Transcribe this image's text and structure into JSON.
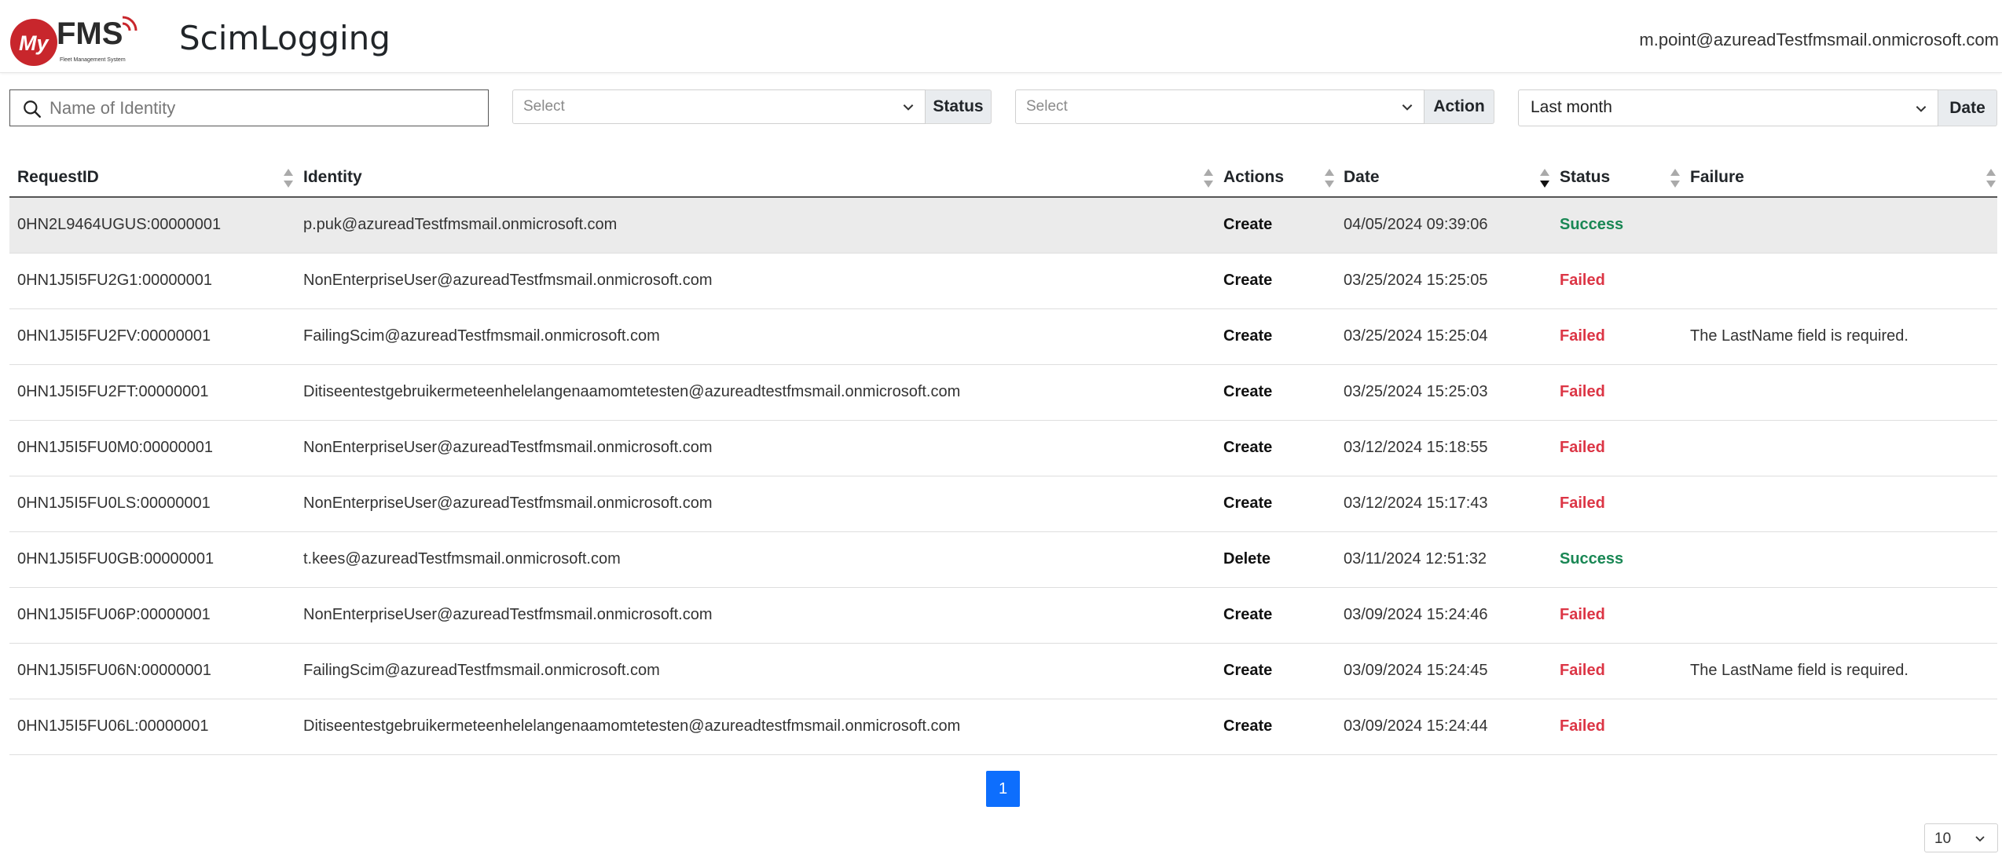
{
  "header": {
    "logo_text": "MyFMS",
    "logo_tagline": "Fleet Management System",
    "title": "ScimLogging",
    "user_email": "m.point@azureadTestfmsmail.onmicrosoft.com"
  },
  "filters": {
    "search_placeholder": "Name of Identity",
    "status": {
      "placeholder": "Select",
      "label": "Status"
    },
    "action": {
      "placeholder": "Select",
      "label": "Action"
    },
    "date": {
      "value": "Last month",
      "label": "Date"
    }
  },
  "table": {
    "columns": [
      "RequestID",
      "Identity",
      "Actions",
      "Date",
      "Status",
      "Failure"
    ],
    "sorted_column": "Date",
    "sort_direction": "descending",
    "highlighted_row": 0,
    "rows": [
      {
        "request_id": "0HN2L9464UGUS:00000001",
        "identity": "p.puk@azureadTestfmsmail.onmicrosoft.com",
        "action": "Create",
        "date": "04/05/2024 09:39:06",
        "status": "Success",
        "failure": ""
      },
      {
        "request_id": "0HN1J5I5FU2G1:00000001",
        "identity": "NonEnterpriseUser@azureadTestfmsmail.onmicrosoft.com",
        "action": "Create",
        "date": "03/25/2024 15:25:05",
        "status": "Failed",
        "failure": ""
      },
      {
        "request_id": "0HN1J5I5FU2FV:00000001",
        "identity": "FailingScim@azureadTestfmsmail.onmicrosoft.com",
        "action": "Create",
        "date": "03/25/2024 15:25:04",
        "status": "Failed",
        "failure": "The LastName field is required."
      },
      {
        "request_id": "0HN1J5I5FU2FT:00000001",
        "identity": "Ditiseentestgebruikermeteenhelelangenaamomtetesten@azureadtestfmsmail.onmicrosoft.com",
        "action": "Create",
        "date": "03/25/2024 15:25:03",
        "status": "Failed",
        "failure": ""
      },
      {
        "request_id": "0HN1J5I5FU0M0:00000001",
        "identity": "NonEnterpriseUser@azureadTestfmsmail.onmicrosoft.com",
        "action": "Create",
        "date": "03/12/2024 15:18:55",
        "status": "Failed",
        "failure": ""
      },
      {
        "request_id": "0HN1J5I5FU0LS:00000001",
        "identity": "NonEnterpriseUser@azureadTestfmsmail.onmicrosoft.com",
        "action": "Create",
        "date": "03/12/2024 15:17:43",
        "status": "Failed",
        "failure": ""
      },
      {
        "request_id": "0HN1J5I5FU0GB:00000001",
        "identity": "t.kees@azureadTestfmsmail.onmicrosoft.com",
        "action": "Delete",
        "date": "03/11/2024 12:51:32",
        "status": "Success",
        "failure": ""
      },
      {
        "request_id": "0HN1J5I5FU06P:00000001",
        "identity": "NonEnterpriseUser@azureadTestfmsmail.onmicrosoft.com",
        "action": "Create",
        "date": "03/09/2024 15:24:46",
        "status": "Failed",
        "failure": ""
      },
      {
        "request_id": "0HN1J5I5FU06N:00000001",
        "identity": "FailingScim@azureadTestfmsmail.onmicrosoft.com",
        "action": "Create",
        "date": "03/09/2024 15:24:45",
        "status": "Failed",
        "failure": "The LastName field is required."
      },
      {
        "request_id": "0HN1J5I5FU06L:00000001",
        "identity": "Ditiseentestgebruikermeteenhelelangenaamomtetesten@azureadtestfmsmail.onmicrosoft.com",
        "action": "Create",
        "date": "03/09/2024 15:24:44",
        "status": "Failed",
        "failure": ""
      }
    ]
  },
  "pagination": {
    "current_page": "1",
    "page_size": "10"
  },
  "colors": {
    "primary": "#0d6efd",
    "success": "#198754",
    "danger": "#dc3545",
    "logo_red": "#c8262c",
    "highlight_row": "#ebebeb"
  }
}
